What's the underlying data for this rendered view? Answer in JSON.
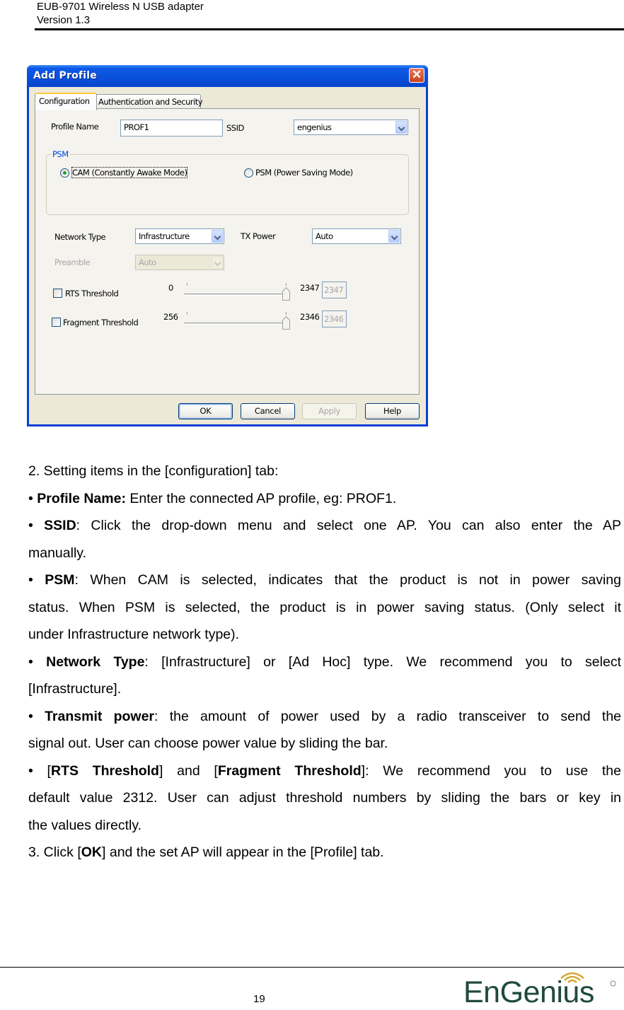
{
  "page_header": {
    "product": "EUB-9701 Wireless N USB adapter",
    "version": "Version 1.3"
  },
  "dialog": {
    "title": "Add Profile",
    "close_glyph": "✕",
    "tabs": [
      {
        "label": "Configuration",
        "active": true
      },
      {
        "label": "Authentication and Security",
        "active": false
      }
    ],
    "profile_name": {
      "label": "Profile Name",
      "value": "PROF1"
    },
    "ssid": {
      "label": "SSID",
      "value": "engenius"
    },
    "psm_group": {
      "title": "PSM",
      "options": [
        {
          "label": "CAM (Constantly Awake Mode)",
          "selected": true
        },
        {
          "label": "PSM (Power Saving Mode)",
          "selected": false
        }
      ]
    },
    "network_type": {
      "label": "Network Type",
      "value": "Infrastructure"
    },
    "tx_power": {
      "label": "TX Power",
      "value": "Auto"
    },
    "preamble": {
      "label": "Preamble",
      "value": "Auto",
      "disabled": true
    },
    "rts_threshold": {
      "label": "RTS Threshold",
      "checked": false,
      "min": "0",
      "max": "2347",
      "value": "2347",
      "slider_fraction": 1.0
    },
    "fragment_threshold": {
      "label": "Fragment Threshold",
      "checked": false,
      "min": "256",
      "max": "2346",
      "value": "2346",
      "slider_fraction": 1.0
    },
    "buttons": {
      "ok": "OK",
      "cancel": "Cancel",
      "apply": "Apply",
      "help": "Help"
    }
  },
  "body": {
    "step2": "2. Setting items in the [configuration] tab:",
    "bullet": "•",
    "profile_name": {
      "term": "Profile Name:",
      "desc": " Enter the connected AP profile, eg: PROF1."
    },
    "ssid": {
      "term": "SSID",
      "desc_l1": ": Click the drop-down menu and select one AP. You can also enter the AP",
      "desc_l2": "manually."
    },
    "psm": {
      "term": "PSM",
      "desc_l1": ": When CAM is selected, indicates that the product is not in power saving",
      "desc_l2": "status. When PSM is selected, the product is in power saving status. (Only select it",
      "desc_l3": "under Infrastructure network type)."
    },
    "network_type": {
      "term": "Network Type",
      "desc_l1": ": [Infrastructure] or [Ad Hoc] type. We recommend you to select",
      "desc_l2": "[Infrastructure]."
    },
    "transmit_power": {
      "term": "Transmit power",
      "desc_l1": ": the amount of power used by a radio transceiver to send the",
      "desc_l2": "signal out. User can choose power value by sliding the bar."
    },
    "thresholds": {
      "open1": " [",
      "term1": "RTS Threshold",
      "mid": "] and [",
      "term2": "Fragment Threshold",
      "desc_l1": "]: We recommend you to use the",
      "desc_l2": "default value 2312. User can adjust threshold numbers by sliding the bars or key in",
      "desc_l3": "the values directly."
    },
    "step3": {
      "pre": "3. Click [",
      "term": "OK",
      "post": "] and the set AP will appear in the [Profile] tab."
    }
  },
  "footer": {
    "page_number": "19",
    "logo_text": "EnGenius",
    "brand_color": "#1f4a3d",
    "logo_accent": "#d4a62a"
  }
}
